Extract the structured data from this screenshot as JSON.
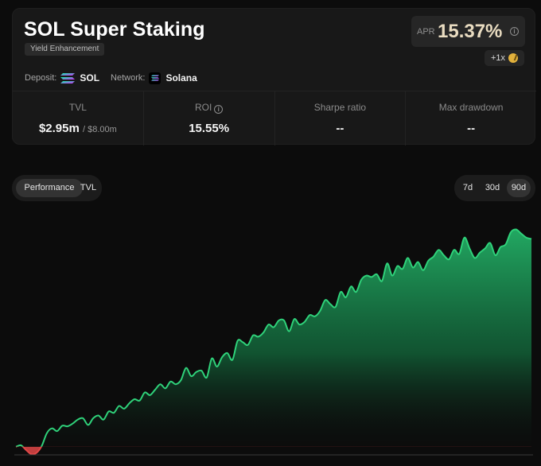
{
  "header": {
    "title": "SOL Super Staking",
    "tag": "Yield Enhancement",
    "deposit_label": "Deposit:",
    "deposit_value": "SOL",
    "network_label": "Network:",
    "network_value": "Solana",
    "deposit_icon": "solana-logo-icon",
    "network_icon": "solana-network-icon"
  },
  "apr": {
    "label": "APR",
    "value": "15.37%",
    "boost": "+1x",
    "accent_color": "#e9dcc1"
  },
  "stats": {
    "tvl": {
      "label": "TVL",
      "value": "$2.95m",
      "sub": "/ $8.00m"
    },
    "roi": {
      "label": "ROI",
      "value": "15.55%"
    },
    "sharpe": {
      "label": "Sharpe ratio",
      "value": "--"
    },
    "drawdown": {
      "label": "Max drawdown",
      "value": "--"
    }
  },
  "tabs": {
    "performance": "Performance",
    "tvl": "TVL",
    "active": "performance"
  },
  "ranges": {
    "d7": "7d",
    "d30": "30d",
    "d90": "90d",
    "active": "90d"
  },
  "chart_data": {
    "type": "area",
    "title": "",
    "xlabel": "",
    "ylabel": "",
    "positive_color": "#2fd27a",
    "negative_color": "#e04848",
    "grid": false,
    "baseline": 0,
    "ylim": [
      -0.6,
      16.5
    ],
    "series": [
      {
        "values": [
          0,
          0.1,
          -0.25,
          -0.55,
          -0.45,
          0.05,
          1.0,
          1.35,
          1.15,
          1.55,
          1.5,
          1.7,
          2.0,
          2.1,
          1.6,
          2.1,
          2.3,
          2.0,
          2.6,
          2.5,
          3.0,
          2.8,
          3.2,
          3.5,
          3.4,
          4.0,
          3.8,
          4.2,
          4.6,
          4.3,
          4.8,
          4.6,
          4.9,
          5.8,
          5.2,
          5.5,
          5.6,
          5.1,
          6.5,
          5.9,
          6.6,
          6.9,
          6.4,
          7.8,
          7.7,
          7.5,
          8.2,
          8.1,
          8.4,
          9.0,
          8.8,
          9.3,
          9.3,
          8.5,
          9.4,
          9.0,
          9.2,
          9.7,
          9.6,
          10.0,
          10.8,
          10.5,
          10.3,
          11.4,
          11.0,
          11.8,
          11.4,
          12.3,
          12.6,
          12.5,
          12.7,
          12.2,
          13.5,
          12.6,
          13.3,
          13.1,
          13.9,
          13.2,
          13.6,
          13.0,
          13.7,
          14.0,
          14.5,
          14.1,
          13.8,
          14.5,
          14.2,
          15.4,
          14.6,
          13.9,
          14.3,
          14.6,
          15.0,
          14.1,
          14.7,
          14.9,
          15.8,
          16.0,
          15.7,
          15.4,
          15.3
        ]
      }
    ]
  }
}
